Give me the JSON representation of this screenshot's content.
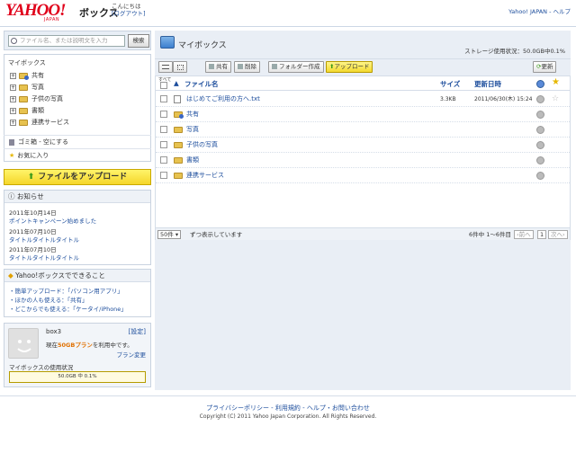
{
  "header": {
    "logo": "YAHOO!",
    "logo_sub": "JAPAN",
    "service": "ボックス",
    "greeting": "こんにちは",
    "logout": "[ログアウト]",
    "links": "Yahoo! JAPAN - ヘルプ"
  },
  "search": {
    "placeholder": "ファイル名、または説明文を入力",
    "button": "検索"
  },
  "tree": {
    "title": "マイボックス",
    "items": [
      {
        "label": "共有",
        "icon": "shared-folder-icon"
      },
      {
        "label": "写真",
        "icon": "folder-icon"
      },
      {
        "label": "子供の写真",
        "icon": "folder-icon"
      },
      {
        "label": "書類",
        "icon": "folder-icon"
      },
      {
        "label": "連携サービス",
        "icon": "folder-icon"
      }
    ],
    "trash": "ゴミ箱 - 空にする",
    "favorites": "お気に入り"
  },
  "upload_big": "ファイルをアップロード",
  "news": {
    "title": "お知らせ",
    "items": [
      {
        "date": "2011年10月14日",
        "text": "ポイントキャンペーン始めました"
      },
      {
        "date": "2011年07月10日",
        "text": "タイトルタイトルタイトル"
      },
      {
        "date": "2011年07月10日",
        "text": "タイトルタイトルタイトル"
      }
    ]
  },
  "cando": {
    "title": "Yahoo!ボックスでできること",
    "items": [
      "・簡単アップロード：「パソコン用アプリ」",
      "・ほかの人も使える：「共有」",
      "・どこからでも使える：「ケータイ/iPhone」"
    ]
  },
  "user": {
    "name": "box3",
    "settings": "[設定]",
    "plan_prefix": "現在",
    "plan_name": "50GBプラン",
    "plan_suffix": "を利用中です。",
    "plan_change": "プラン変更",
    "usage_label": "マイボックスの使用状況",
    "usage_text": "50.0GB 中 0.1%",
    "usage_percent": 0.1
  },
  "main": {
    "title": "マイボックス",
    "storage": "ストレージ使用状況：50.0GB中0.1%",
    "toolbar": {
      "share": "共有",
      "delete": "削除",
      "new_folder": "フォルダー作成",
      "upload": "アップロード",
      "refresh": "更新"
    },
    "columns": {
      "select_all": "すべて",
      "name": "ファイル名",
      "size": "サイズ",
      "date": "更新日時"
    },
    "files": [
      {
        "name": "はじめてご利用の方へ.txt",
        "size": "3.3KB",
        "date": "2011/06/30(木) 15:24",
        "type": "doc"
      },
      {
        "name": "共有",
        "size": "",
        "date": "",
        "type": "shared"
      },
      {
        "name": "写真",
        "size": "",
        "date": "",
        "type": "folder"
      },
      {
        "name": "子供の写真",
        "size": "",
        "date": "",
        "type": "folder"
      },
      {
        "name": "書類",
        "size": "",
        "date": "",
        "type": "folder"
      },
      {
        "name": "連携サービス",
        "size": "",
        "date": "",
        "type": "folder"
      }
    ],
    "pager": {
      "per_page": "50件",
      "per_page_suffix": "ずつ表示しています",
      "count": "6件中 1〜6件目",
      "prev": "前へ",
      "page": "1",
      "next": "次へ"
    }
  },
  "footer": {
    "links": "プライバシーポリシー - 利用規約 - ヘルプ・お問い合わせ",
    "copyright": "Copyright (C) 2011 Yahoo Japan Corporation. All Rights Reserved."
  }
}
